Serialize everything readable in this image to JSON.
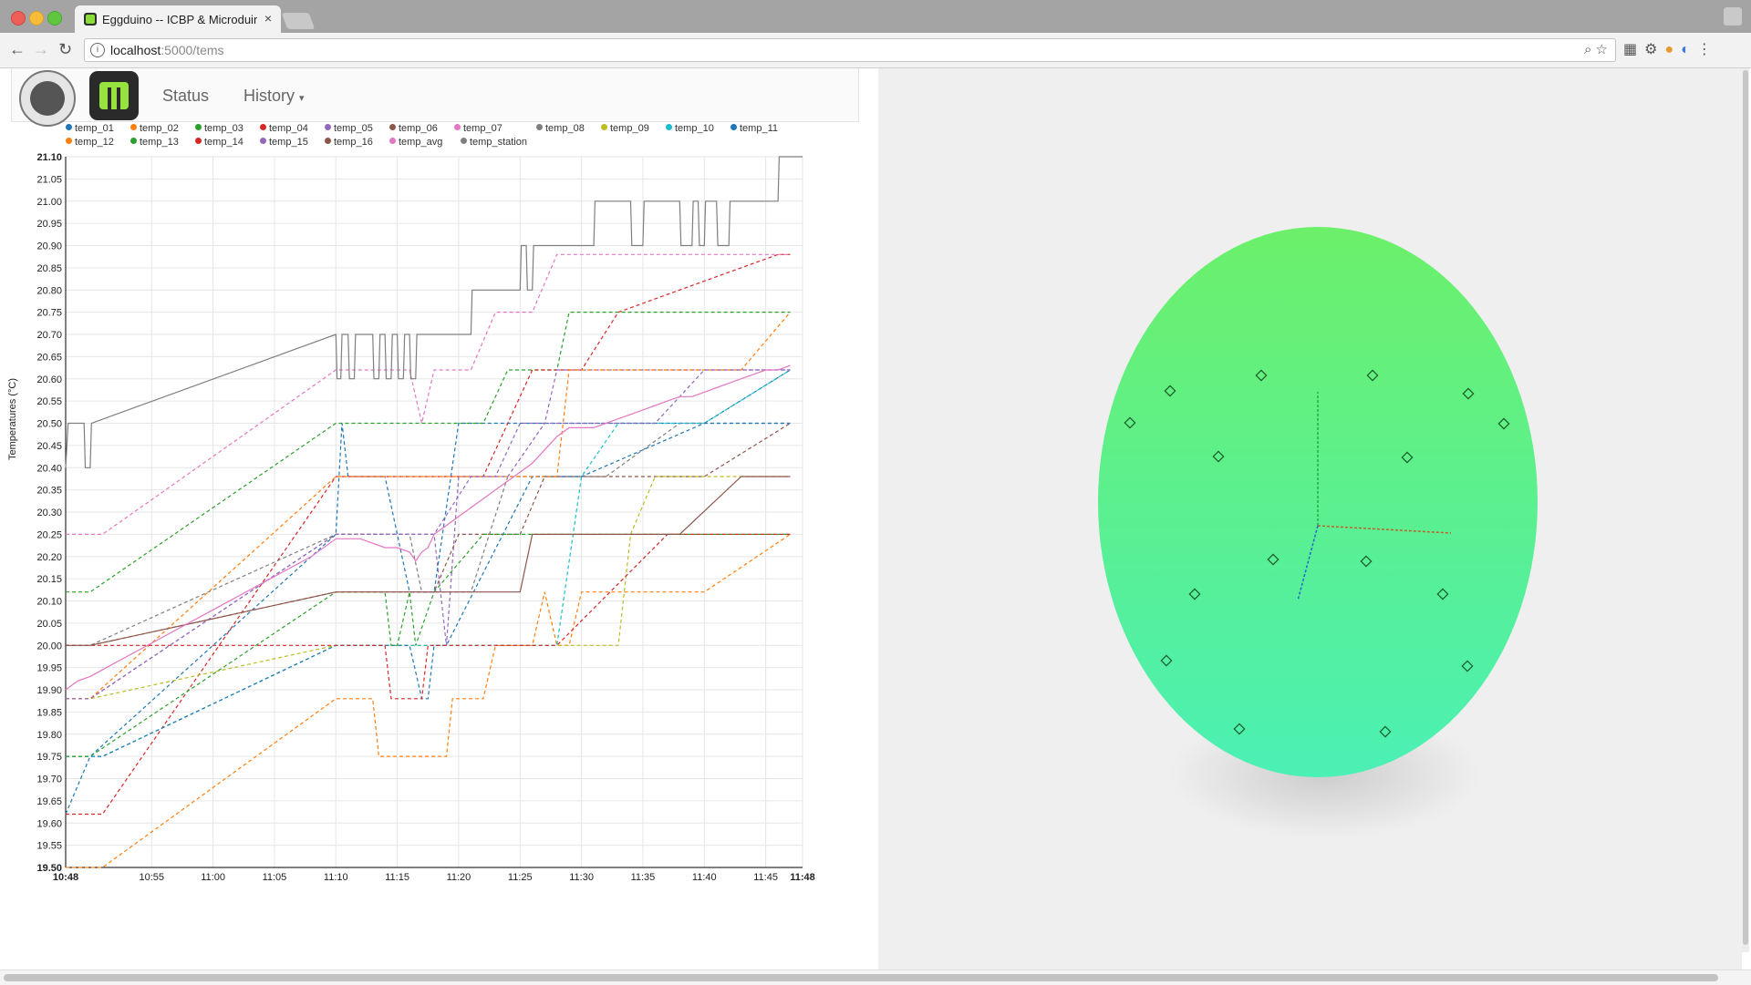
{
  "browser": {
    "tab_title": "Eggduino -- ICBP & Microduino",
    "tab_close": "×",
    "url_host": "localhost",
    "url_rest": ":5000/tems",
    "info_icon": "i"
  },
  "nav": {
    "status": "Status",
    "history": "History"
  },
  "chart_data": {
    "type": "line",
    "ylabel": "Temperatures (°C)",
    "ylim": [
      19.5,
      21.1
    ],
    "y_ticks": [
      "19.50",
      "19.55",
      "19.60",
      "19.65",
      "19.70",
      "19.75",
      "19.80",
      "19.85",
      "19.90",
      "19.95",
      "20.00",
      "20.05",
      "20.10",
      "20.15",
      "20.20",
      "20.25",
      "20.30",
      "20.35",
      "20.40",
      "20.45",
      "20.50",
      "20.55",
      "20.60",
      "20.65",
      "20.70",
      "20.75",
      "20.80",
      "20.85",
      "20.90",
      "20.95",
      "21.00",
      "21.05",
      "21.10"
    ],
    "x_ticks": [
      "10:48",
      "10:55",
      "11:00",
      "11:05",
      "11:10",
      "11:15",
      "11:20",
      "11:25",
      "11:30",
      "11:35",
      "11:40",
      "11:45",
      "11:48"
    ],
    "x_tick_minutes": [
      0,
      7,
      12,
      17,
      22,
      27,
      32,
      37,
      42,
      47,
      52,
      57,
      60
    ],
    "legend_rows": [
      [
        "temp_01",
        "temp_02",
        "temp_03",
        "temp_04",
        "temp_05",
        "temp_06",
        "temp_07",
        "temp_08",
        "temp_09",
        "temp_10",
        "temp_11"
      ],
      [
        "temp_12",
        "temp_13",
        "temp_14",
        "temp_15",
        "temp_16",
        "temp_avg",
        "temp_station"
      ]
    ],
    "series": [
      {
        "name": "temp_01",
        "color": "#1f77b4",
        "dash": true,
        "x": [
          0,
          2,
          22,
          22.5,
          23,
          25,
          26,
          28,
          30,
          32,
          40,
          52,
          59
        ],
        "y": [
          19.62,
          19.75,
          20.25,
          20.5,
          20.38,
          20.38,
          20.38,
          20.12,
          20.12,
          20.5,
          20.5,
          20.5,
          20.62
        ]
      },
      {
        "name": "temp_02",
        "color": "#ff7f0e",
        "dash": true,
        "x": [
          0,
          3,
          22,
          25,
          25.5,
          28,
          31,
          31.5,
          34,
          35,
          38,
          39,
          40,
          41,
          42,
          52,
          59
        ],
        "y": [
          19.5,
          19.5,
          19.88,
          19.88,
          19.75,
          19.75,
          19.75,
          19.88,
          19.88,
          20.0,
          20.0,
          20.12,
          20.0,
          20.0,
          20.12,
          20.12,
          20.25
        ]
      },
      {
        "name": "temp_03",
        "color": "#2ca02c",
        "dash": true,
        "x": [
          0,
          2,
          22,
          26,
          27,
          28,
          29,
          30,
          34,
          36,
          40,
          41,
          49,
          55,
          59
        ],
        "y": [
          20.12,
          20.12,
          20.5,
          20.5,
          20.5,
          20.5,
          20.5,
          20.5,
          20.5,
          20.62,
          20.62,
          20.75,
          20.75,
          20.75,
          20.75
        ]
      },
      {
        "name": "temp_04",
        "color": "#d62728",
        "dash": true,
        "x": [
          0,
          3,
          22,
          30,
          31,
          32,
          34,
          38,
          42,
          45,
          58,
          59
        ],
        "y": [
          19.62,
          19.62,
          20.38,
          20.38,
          20.38,
          20.38,
          20.38,
          20.62,
          20.62,
          20.75,
          20.88,
          20.88
        ]
      },
      {
        "name": "temp_05",
        "color": "#9467bd",
        "dash": true,
        "x": [
          0,
          2,
          22,
          26,
          30,
          31,
          32,
          35,
          37,
          39,
          40,
          42,
          45,
          59
        ],
        "y": [
          19.88,
          19.88,
          20.25,
          20.25,
          20.25,
          20.0,
          20.38,
          20.38,
          20.5,
          20.5,
          20.62,
          20.62,
          20.62,
          20.62
        ]
      },
      {
        "name": "temp_06",
        "color": "#8c564b",
        "dash": true,
        "x": [
          0,
          2,
          22,
          30,
          32,
          35,
          37,
          39,
          41,
          44,
          47,
          52,
          59
        ],
        "y": [
          20.0,
          20.0,
          20.12,
          20.12,
          20.25,
          20.25,
          20.25,
          20.38,
          20.38,
          20.38,
          20.38,
          20.38,
          20.5
        ]
      },
      {
        "name": "temp_07",
        "color": "#e377c2",
        "dash": true,
        "x": [
          0,
          3,
          22,
          27,
          28,
          29,
          30,
          33,
          35,
          38,
          40,
          41,
          49,
          55,
          59
        ],
        "y": [
          20.25,
          20.25,
          20.62,
          20.62,
          20.62,
          20.5,
          20.62,
          20.62,
          20.75,
          20.75,
          20.88,
          20.88,
          20.88,
          20.88,
          20.88
        ]
      },
      {
        "name": "temp_08",
        "color": "#7f7f7f",
        "dash": true,
        "x": [
          0,
          2,
          22,
          28,
          29,
          30,
          33,
          36,
          41,
          44,
          50,
          55,
          58,
          59
        ],
        "y": [
          20.0,
          20.0,
          20.25,
          20.25,
          20.12,
          20.12,
          20.12,
          20.38,
          20.38,
          20.38,
          20.5,
          20.5,
          20.5,
          20.5
        ]
      },
      {
        "name": "temp_09",
        "color": "#bcbd22",
        "dash": true,
        "x": [
          0,
          2,
          22,
          33,
          45,
          46,
          48,
          55,
          59
        ],
        "y": [
          19.88,
          19.88,
          20.0,
          20.0,
          20.0,
          20.25,
          20.38,
          20.38,
          20.38
        ]
      },
      {
        "name": "temp_10",
        "color": "#17becf",
        "dash": true,
        "x": [
          0,
          3,
          22,
          30,
          40,
          42,
          45,
          50,
          52,
          59
        ],
        "y": [
          19.75,
          19.75,
          20.0,
          20.0,
          20.0,
          20.38,
          20.5,
          20.5,
          20.5,
          20.62
        ]
      },
      {
        "name": "temp_11",
        "color": "#1f77b4",
        "dash": true,
        "x": [
          0,
          3,
          22,
          28,
          29,
          29.5,
          30,
          31,
          38,
          41,
          42,
          52,
          59
        ],
        "y": [
          19.75,
          19.75,
          20.0,
          20.0,
          19.88,
          19.88,
          20.0,
          20.0,
          20.38,
          20.38,
          20.38,
          20.5,
          20.5
        ]
      },
      {
        "name": "temp_12",
        "color": "#ff7f0e",
        "dash": true,
        "x": [
          0,
          2,
          22,
          30,
          35,
          36,
          40,
          41,
          45,
          50,
          55,
          59
        ],
        "y": [
          19.88,
          19.88,
          20.38,
          20.38,
          20.38,
          20.38,
          20.38,
          20.62,
          20.62,
          20.62,
          20.62,
          20.75
        ]
      },
      {
        "name": "temp_13",
        "color": "#2ca02c",
        "dash": true,
        "x": [
          0,
          2,
          22,
          26,
          26.5,
          27,
          28,
          28.5,
          30,
          34,
          36,
          40,
          55,
          59
        ],
        "y": [
          19.75,
          19.75,
          20.12,
          20.12,
          20.0,
          20.0,
          20.12,
          20.0,
          20.12,
          20.25,
          20.25,
          20.25,
          20.25,
          20.25
        ]
      },
      {
        "name": "temp_14",
        "color": "#d62728",
        "dash": true,
        "x": [
          0,
          2,
          22,
          26,
          26.5,
          29,
          29.5,
          32,
          40,
          49,
          55,
          59
        ],
        "y": [
          20.0,
          20.0,
          20.0,
          20.0,
          19.88,
          19.88,
          20.0,
          20.0,
          20.0,
          20.25,
          20.25,
          20.25
        ]
      },
      {
        "name": "temp_15",
        "color": "#9467bd",
        "dash": true,
        "x": [
          0,
          2,
          22,
          28,
          30,
          33,
          36,
          39,
          42,
          45,
          48,
          52,
          59
        ],
        "y": [
          19.88,
          19.88,
          20.25,
          20.25,
          20.25,
          20.38,
          20.38,
          20.5,
          20.5,
          20.5,
          20.5,
          20.62,
          20.62
        ]
      },
      {
        "name": "temp_16",
        "color": "#8c564b",
        "dash": false,
        "x": [
          0,
          2,
          22,
          37,
          38,
          40,
          42,
          45,
          50,
          55,
          59
        ],
        "y": [
          20.0,
          20.0,
          20.12,
          20.12,
          20.25,
          20.25,
          20.25,
          20.25,
          20.25,
          20.38,
          20.38
        ]
      },
      {
        "name": "temp_avg",
        "color": "#e377c2",
        "dash": false,
        "x": [
          0,
          1,
          2,
          4,
          8,
          12,
          16,
          20,
          22,
          24,
          26,
          27,
          28,
          28.5,
          29,
          29.5,
          30,
          31,
          32,
          33,
          34,
          35,
          36,
          37,
          38,
          39,
          40,
          41,
          42,
          43,
          44,
          45,
          46,
          47,
          48,
          49,
          50,
          51,
          52,
          53,
          54,
          55,
          56,
          57,
          58,
          59
        ],
        "y": [
          19.9,
          19.92,
          19.93,
          19.96,
          20.02,
          20.08,
          20.14,
          20.2,
          20.24,
          20.24,
          20.22,
          20.22,
          20.21,
          20.19,
          20.21,
          20.22,
          20.25,
          20.27,
          20.29,
          20.31,
          20.33,
          20.35,
          20.37,
          20.39,
          20.41,
          20.44,
          20.47,
          20.49,
          20.49,
          20.49,
          20.5,
          20.51,
          20.52,
          20.53,
          20.54,
          20.55,
          20.56,
          20.56,
          20.57,
          20.58,
          20.59,
          20.6,
          20.61,
          20.62,
          20.62,
          20.63
        ]
      },
      {
        "name": "temp_station",
        "color": "#7f7f7f",
        "dash": false,
        "x": [
          0,
          0.2,
          1.5,
          1.6,
          2,
          2.1,
          22,
          22.1,
          22.4,
          22.5,
          23,
          23.1,
          23.5,
          23.6,
          24,
          25,
          25.1,
          25.5,
          25.6,
          26,
          26.1,
          26.5,
          26.6,
          27,
          27.1,
          27.5,
          27.6,
          28,
          28.1,
          28.5,
          28.6,
          29,
          32,
          33,
          33.1,
          37,
          37.1,
          37.5,
          37.6,
          38,
          38.1,
          43,
          43.1,
          46,
          46.1,
          47,
          47.1,
          50,
          50.1,
          51,
          51.1,
          51.5,
          51.6,
          52,
          52.1,
          53,
          53.1,
          54,
          54.1,
          58,
          58.1,
          60
        ],
        "y": [
          20.4,
          20.5,
          20.5,
          20.4,
          20.4,
          20.5,
          20.7,
          20.6,
          20.6,
          20.7,
          20.7,
          20.6,
          20.6,
          20.7,
          20.7,
          20.7,
          20.6,
          20.6,
          20.7,
          20.7,
          20.6,
          20.6,
          20.7,
          20.7,
          20.6,
          20.6,
          20.7,
          20.7,
          20.6,
          20.6,
          20.7,
          20.7,
          20.7,
          20.7,
          20.8,
          20.8,
          20.9,
          20.9,
          20.8,
          20.8,
          20.9,
          20.9,
          21.0,
          21.0,
          20.9,
          20.9,
          21.0,
          21.0,
          20.9,
          20.9,
          21.0,
          21.0,
          20.9,
          20.9,
          21.0,
          21.0,
          20.9,
          20.9,
          21.0,
          21.0,
          21.1,
          21.1
        ]
      }
    ]
  },
  "egg_view": {
    "colors": {
      "top": "#6cf06a",
      "bottom": "#4bf0b4",
      "shadow": "#c9c9c9"
    }
  }
}
